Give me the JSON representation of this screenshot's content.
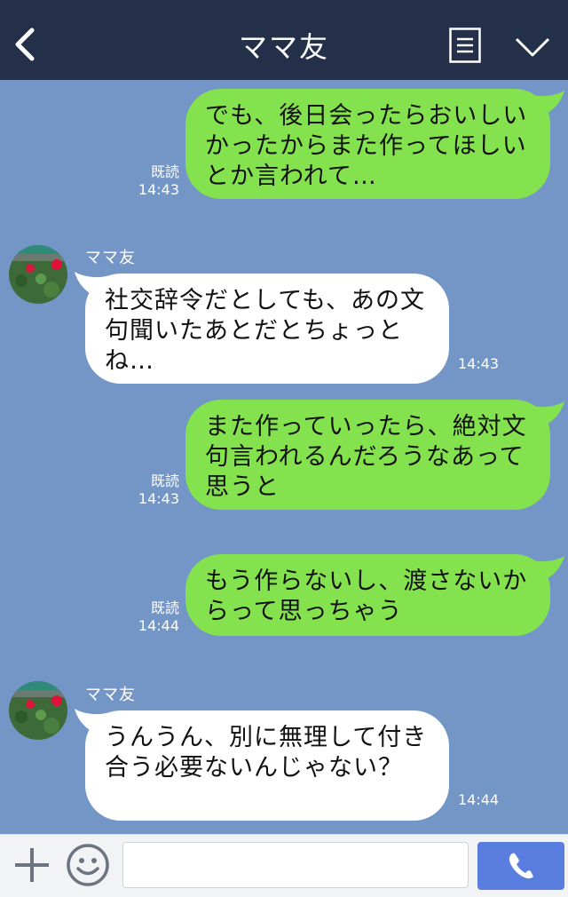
{
  "header": {
    "title": "ママ友"
  },
  "messages": [
    {
      "text": "でも、後日会ったらおいしいかったからまた作ってほしいとか言われて…",
      "read": "既読",
      "time": "14:43"
    },
    {
      "sender": "ママ友",
      "text": "社交辞令だとしても、あの文句聞いたあとだとちょっとね…",
      "time": "14:43"
    },
    {
      "text": "また作っていったら、絶対文句言われるんだろうなあって思うと",
      "read": "既読",
      "time": "14:43"
    },
    {
      "text": "もう作らないし、渡さないからって思っちゃう",
      "read": "既読",
      "time": "14:44"
    },
    {
      "sender": "ママ友",
      "text": "うんうん、別に無理して付き合う必要ないんじゃない？",
      "time": "14:44"
    }
  ],
  "colors": {
    "background": "#7496c6",
    "header": "#243049",
    "outgoing_bubble": "#84e24e",
    "incoming_bubble": "#ffffff",
    "call_button": "#5a7ee0"
  },
  "icons": [
    "back-icon",
    "menu-icon",
    "chevron-down-icon",
    "plus-icon",
    "emoji-icon",
    "phone-icon"
  ]
}
